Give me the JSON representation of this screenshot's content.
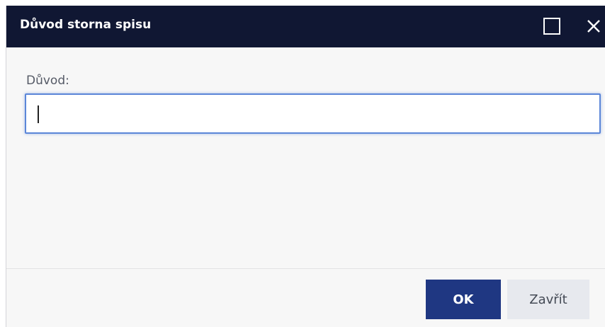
{
  "dialog": {
    "title": "Důvod storna spisu",
    "maximize_icon": "maximize-icon",
    "close_icon": "close-icon"
  },
  "form": {
    "reason_label": "Důvod:",
    "reason_value": ""
  },
  "footer": {
    "ok_label": "OK",
    "close_label": "Zavřít"
  },
  "colors": {
    "titlebar": "#101733",
    "primary_button": "#1f3782",
    "secondary_button": "#e7e9ee",
    "focus_border": "#5b86d8"
  }
}
